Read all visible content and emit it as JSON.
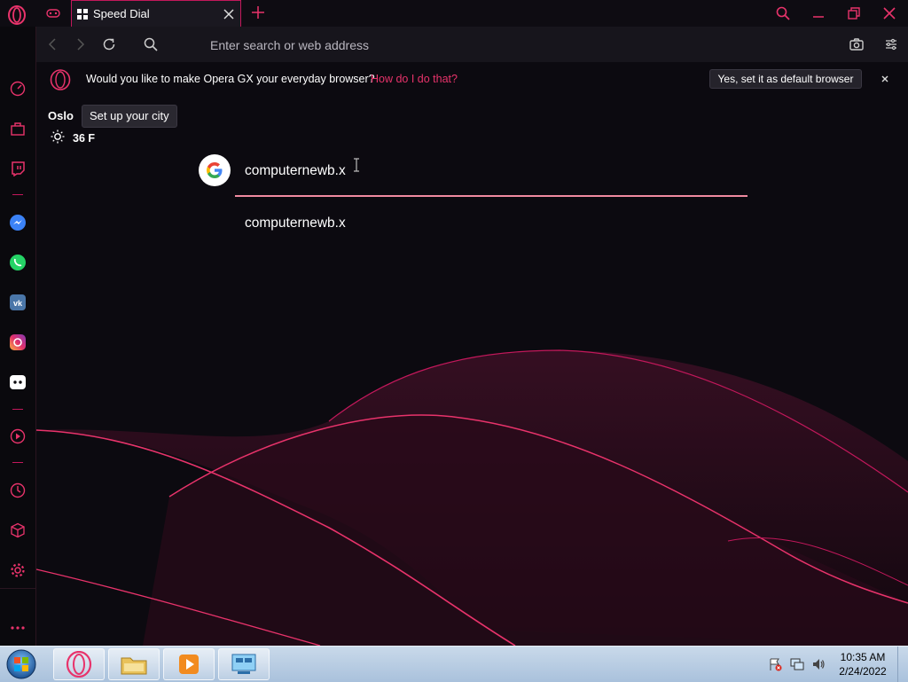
{
  "browser": {
    "tab_title": "Speed Dial",
    "address_placeholder": "Enter search or web address"
  },
  "banner": {
    "message": "Would you like to make Opera GX your everyday browser?",
    "how_link": "How do I do that?",
    "set_default_label": "Yes, set it as default browser"
  },
  "weather": {
    "city": "Oslo",
    "setup_label": "Set up your city",
    "temperature": "36 F"
  },
  "search": {
    "query": "computernewb.x",
    "suggestions": [
      "computernewb.x"
    ]
  },
  "taskbar": {
    "time": "10:35 AM",
    "date": "2/24/2022"
  },
  "colors": {
    "accent": "#e8336b",
    "tab_border": "#c2185b",
    "search_underline": "#f08aa0"
  },
  "icons": {
    "sidebar": [
      "speedometer-icon",
      "shopping-bag-icon",
      "twitch-icon",
      "messenger-icon",
      "whatsapp-icon",
      "vk-icon",
      "instagram-icon",
      "discord-icon",
      "player-icon",
      "history-icon",
      "cube-icon",
      "settings-icon",
      "more-icon"
    ]
  }
}
